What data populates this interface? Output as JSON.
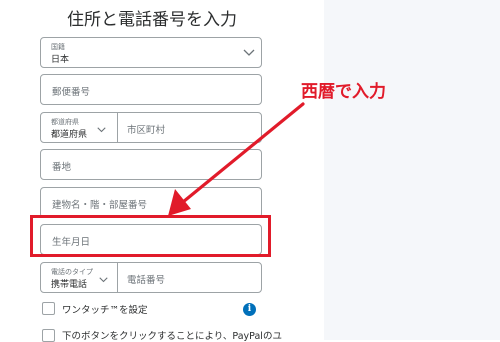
{
  "form": {
    "title": "住所と電話番号を入力",
    "country": {
      "label": "国籍",
      "value": "日本"
    },
    "postal": {
      "placeholder": "郵便番号"
    },
    "prefecture": {
      "label": "都道府県",
      "value": "都道府県"
    },
    "city": {
      "placeholder": "市区町村"
    },
    "address": {
      "placeholder": "番地"
    },
    "building": {
      "placeholder": "建物名・階・部屋番号"
    },
    "birthdate": {
      "placeholder": "生年月日"
    },
    "phone_type": {
      "label": "電話のタイプ",
      "value": "携帯電話"
    },
    "phone": {
      "placeholder": "電話番号"
    },
    "onetouch": {
      "label": "ワンタッチ™を設定"
    },
    "terms": {
      "label": "下のボタンをクリックすることにより、PayPalのユ"
    },
    "info_icon": "info-circle-icon"
  },
  "annotation": {
    "text": "西暦で入力",
    "color": "#e11b2a"
  }
}
